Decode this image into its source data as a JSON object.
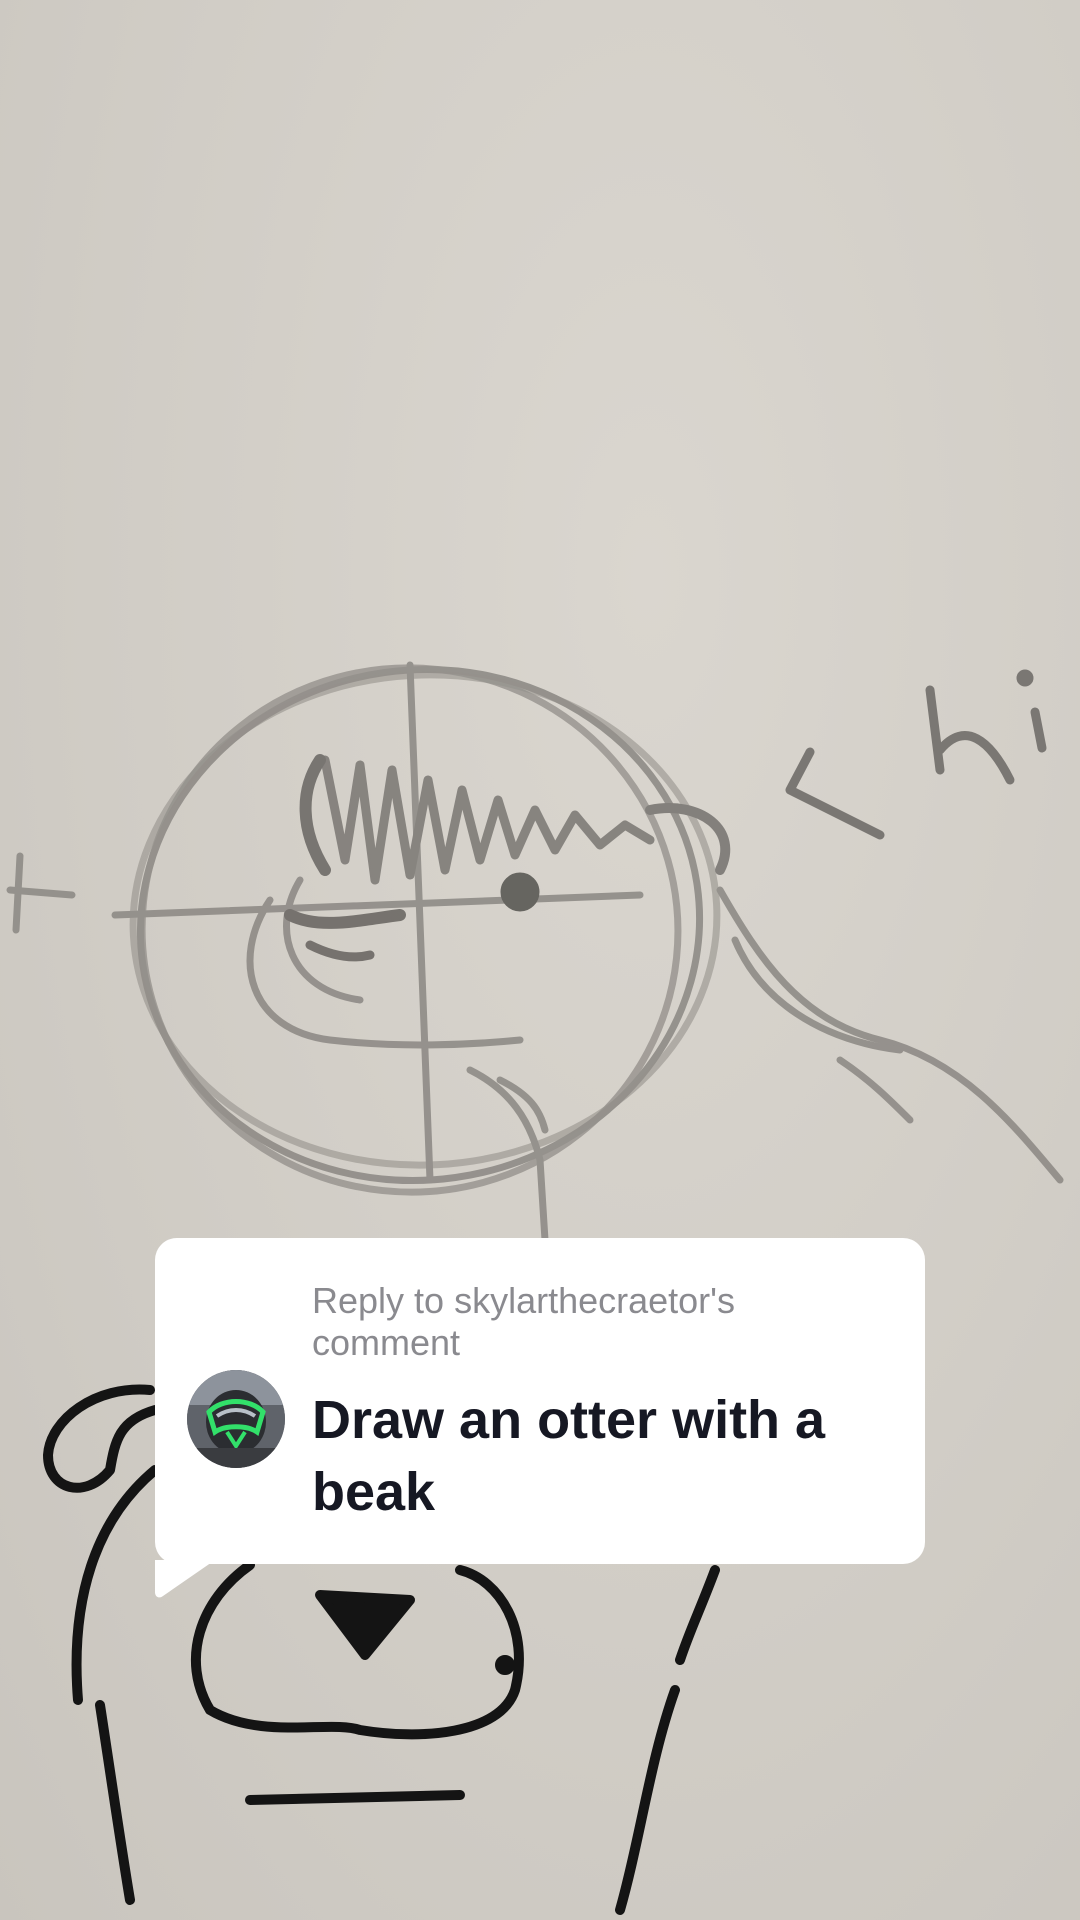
{
  "reply": {
    "header": "Reply to skylarthecraetor's comment",
    "body": "Draw an otter with a beak"
  },
  "scene": {
    "sketch_text": "< hi"
  },
  "icons": {
    "avatar": "user-avatar-green-mask"
  },
  "colors": {
    "paper": "#d3cfc8",
    "pencil": "#8c8a86",
    "marker": "#141414",
    "card_bg": "#ffffff",
    "header_text": "#8a8a8f",
    "body_text": "#161823"
  }
}
